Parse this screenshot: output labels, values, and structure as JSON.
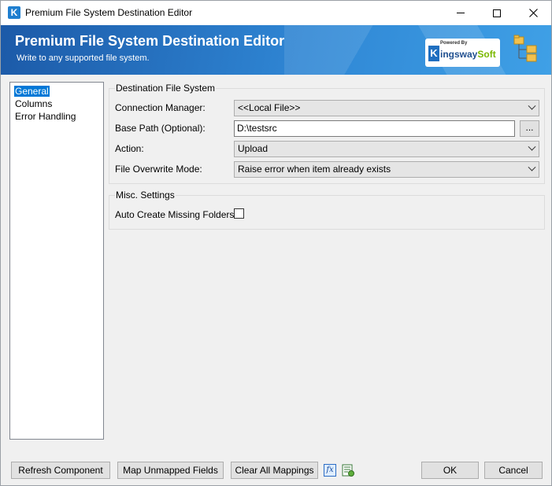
{
  "window": {
    "title": "Premium File System Destination Editor",
    "app_icon_letter": "K"
  },
  "banner": {
    "title": "Premium File System Destination Editor",
    "subtitle": "Write to any supported file system.",
    "brand_powered": "Powered By",
    "brand_k": "K",
    "brand_name_main": "ingsway",
    "brand_name_soft": "Soft"
  },
  "nav": {
    "items": [
      {
        "label": "General",
        "selected": true
      },
      {
        "label": "Columns",
        "selected": false
      },
      {
        "label": "Error Handling",
        "selected": false
      }
    ]
  },
  "destination": {
    "group_label": "Destination File System",
    "connection_manager_label": "Connection Manager:",
    "connection_manager_value": "<<Local File>>",
    "base_path_label": "Base Path (Optional):",
    "base_path_value": "D:\\testsrc",
    "browse_label": "...",
    "action_label": "Action:",
    "action_value": "Upload",
    "overwrite_label": "File Overwrite Mode:",
    "overwrite_value": "Raise error when item already exists"
  },
  "misc": {
    "group_label": "Misc. Settings",
    "auto_create_label": "Auto Create Missing Folders:",
    "auto_create_checked": false
  },
  "footer": {
    "refresh_label": "Refresh Component",
    "map_unmapped_label": "Map Unmapped Fields",
    "clear_mappings_label": "Clear All Mappings",
    "fx_icon_label": "fx",
    "ok_label": "OK",
    "cancel_label": "Cancel"
  },
  "colors": {
    "banner_start": "#1c5aa8",
    "banner_end": "#3fa0e6",
    "selection": "#0078d7"
  }
}
